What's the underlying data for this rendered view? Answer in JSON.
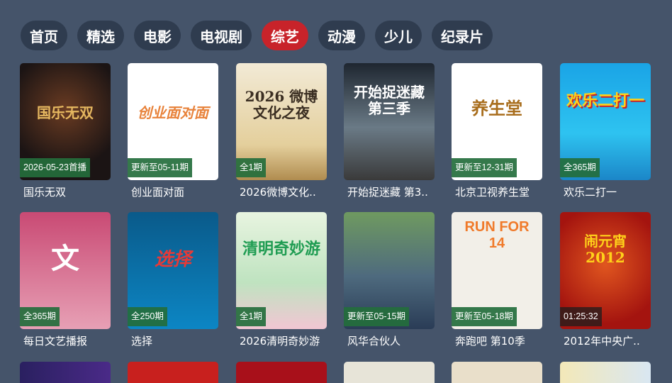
{
  "nav": {
    "tabs": [
      {
        "label": "首页"
      },
      {
        "label": "精选"
      },
      {
        "label": "电影"
      },
      {
        "label": "电视剧"
      },
      {
        "label": "综艺"
      },
      {
        "label": "动漫"
      },
      {
        "label": "少儿"
      },
      {
        "label": "纪录片"
      }
    ],
    "active_index": 4,
    "active_color": "#c8232a"
  },
  "rows": [
    [
      {
        "title": "国乐无双",
        "badge": "2026-05-23首播",
        "art": "国乐无双"
      },
      {
        "title": "创业面对面",
        "badge": "更新至05-11期",
        "art": "创业面对面"
      },
      {
        "title": "2026微博文化..",
        "badge": "全1期",
        "art": "2026 微博文化之夜"
      },
      {
        "title": "开始捉迷藏 第3..",
        "badge": "",
        "art": "开始捉迷藏 第三季"
      },
      {
        "title": "北京卫视养生堂",
        "badge": "更新至12-31期",
        "art": "养生堂"
      },
      {
        "title": "欢乐二打一",
        "badge": "全365期",
        "art": "欢乐二打一"
      }
    ],
    [
      {
        "title": "每日文艺播报",
        "badge": "全365期",
        "art": "文"
      },
      {
        "title": "选择",
        "badge": "全250期",
        "art": "选择"
      },
      {
        "title": "2026清明奇妙游",
        "badge": "全1期",
        "art": "清明奇妙游"
      },
      {
        "title": "风华合伙人",
        "badge": "更新至05-15期",
        "art": ""
      },
      {
        "title": "奔跑吧 第10季",
        "badge": "更新至05-18期",
        "art": "RUN FOR 14"
      },
      {
        "title": "2012年中央广..",
        "badge": "01:25:32",
        "art": "闹元宵 2012"
      }
    ]
  ]
}
